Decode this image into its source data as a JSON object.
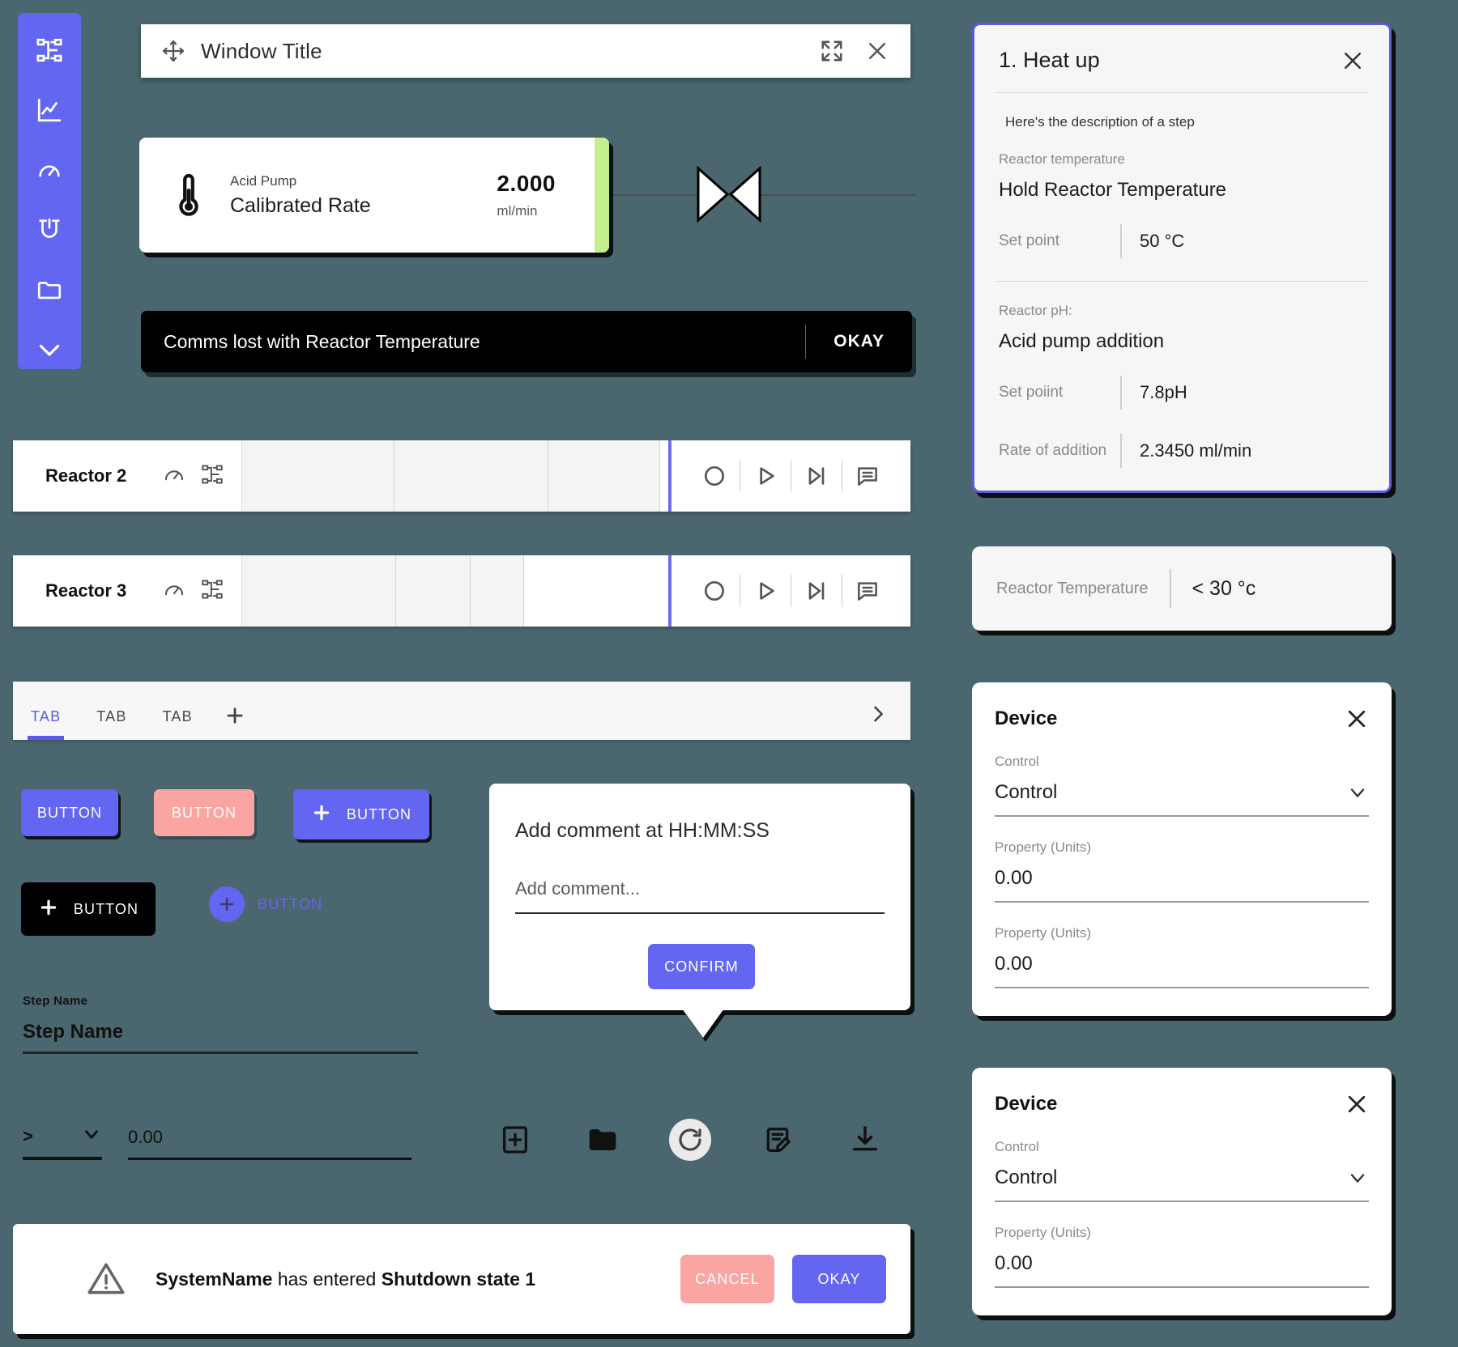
{
  "theme": {
    "background": "#4a666e",
    "accent": "#6366f1",
    "danger": "#fba5a2",
    "success": "#c3f08a",
    "card_border": "#5b5bdc"
  },
  "sidebar": {
    "items": [
      {
        "icon": "sitemap-icon",
        "name": "sidebar-item-sitemap"
      },
      {
        "icon": "chart-line-icon",
        "name": "sidebar-item-chart"
      },
      {
        "icon": "gauge-icon",
        "name": "sidebar-item-gauge"
      },
      {
        "icon": "reactor-icon",
        "name": "sidebar-item-reactor"
      },
      {
        "icon": "folder-icon",
        "name": "sidebar-item-folder"
      },
      {
        "icon": "chevron-down-icon",
        "name": "sidebar-item-expand"
      }
    ]
  },
  "window": {
    "title": "Window Title",
    "move_icon": "move-icon",
    "expand_icon": "expand-icon",
    "close_icon": "close-icon"
  },
  "calibration_card": {
    "icon": "thermometer-icon",
    "device": "Acid Pump",
    "property": "Calibrated Rate",
    "value": "2.000",
    "unit": "ml/min",
    "status_color": "#c3f08a"
  },
  "toast": {
    "message": "Comms lost with Reactor Temperature",
    "action_label": "OKAY"
  },
  "reactors": [
    {
      "name": "Reactor 2",
      "icons": [
        "gauge-icon",
        "sitemap-icon"
      ],
      "transport": [
        "record-icon",
        "play-icon",
        "skip-next-icon",
        "comment-icon"
      ]
    },
    {
      "name": "Reactor 3",
      "icons": [
        "gauge-icon",
        "sitemap-icon"
      ],
      "transport": [
        "record-icon",
        "play-icon",
        "skip-next-icon",
        "comment-icon"
      ]
    }
  ],
  "tabs": {
    "items": [
      {
        "label": "TAB",
        "active": true
      },
      {
        "label": "TAB",
        "active": false
      },
      {
        "label": "TAB",
        "active": false
      }
    ],
    "add_icon": "plus-icon",
    "overflow_icon": "chevron-right-icon"
  },
  "buttons": {
    "primary": "BUTTON",
    "danger": "BUTTON",
    "icon_primary": "BUTTON",
    "black": "BUTTON",
    "ghost": "BUTTON",
    "plus_icon": "plus-icon"
  },
  "step_field": {
    "label": "Step Name",
    "value": "Step Name"
  },
  "operator_row": {
    "operator": ">",
    "chevron_icon": "chevron-down-icon",
    "number_value": "0.00"
  },
  "icon_toolbar": {
    "items": [
      {
        "icon": "add-box-icon",
        "name": "add-item-button",
        "highlight": false
      },
      {
        "icon": "folder-icon",
        "name": "open-folder-button",
        "highlight": false
      },
      {
        "icon": "refresh-icon",
        "name": "refresh-button",
        "highlight": true
      },
      {
        "icon": "edit-document-icon",
        "name": "edit-document-button",
        "highlight": false
      },
      {
        "icon": "download-icon",
        "name": "download-button",
        "highlight": false
      }
    ]
  },
  "comment_popover": {
    "title": "Add comment at HH:MM:SS",
    "placeholder": "Add comment...",
    "confirm_label": "CONFIRM"
  },
  "alert_bar": {
    "icon": "warning-icon",
    "system_name": "SystemName",
    "middle_text": " has entered ",
    "state": "Shutdown state 1",
    "cancel_label": "CANCEL",
    "okay_label": "OKAY"
  },
  "step_card": {
    "title": "1. Heat up",
    "close_icon": "close-icon",
    "description": "Here's the description of a step",
    "groups": [
      {
        "label": "Reactor temperature",
        "value": "Hold Reactor Temperature",
        "rows": [
          {
            "key": "Set point",
            "value": "50 °C"
          }
        ]
      },
      {
        "label": "Reactor pH:",
        "value": "Acid pump addition",
        "rows": [
          {
            "key": "Set poiint",
            "value": "7.8pH"
          },
          {
            "key": "Rate of addition",
            "value": "2.3450 ml/min"
          }
        ]
      }
    ]
  },
  "condition_chip": {
    "key": "Reactor Temperature",
    "value": "< 30 °c"
  },
  "device_cards": [
    {
      "title": "Device",
      "close_icon": "close-icon",
      "fields": [
        {
          "label": "Control",
          "value": "Control",
          "type": "select"
        },
        {
          "label": "Property (Units)",
          "value": "0.00",
          "type": "text"
        },
        {
          "label": "Property (Units)",
          "value": "0.00",
          "type": "text"
        }
      ]
    },
    {
      "title": "Device",
      "close_icon": "close-icon",
      "fields": [
        {
          "label": "Control",
          "value": "Control",
          "type": "select"
        },
        {
          "label": "Property (Units)",
          "value": "0.00",
          "type": "text"
        }
      ]
    }
  ]
}
